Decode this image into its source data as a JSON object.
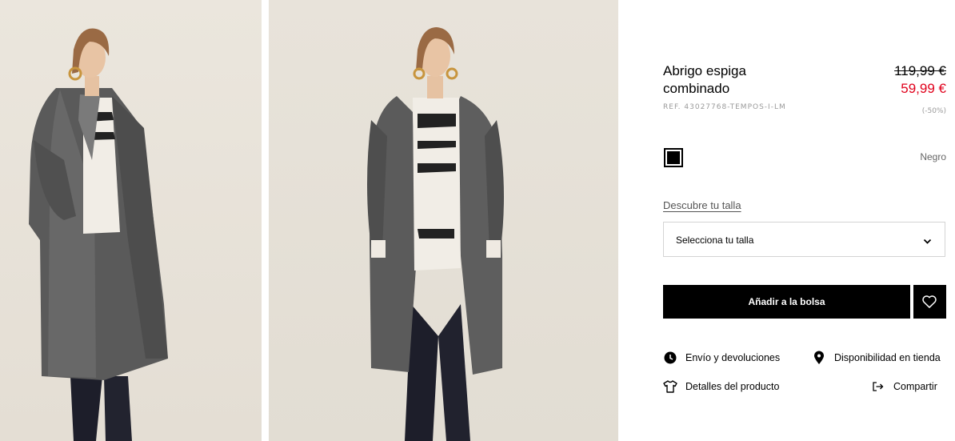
{
  "product": {
    "title": "Abrigo espiga combinado",
    "reference": "REF. 43027768-TEMPOS-I-LM",
    "original_price": "119,99 €",
    "sale_price": "59,99 €",
    "discount": "(-50%)",
    "sale_color": "#e0001b"
  },
  "color": {
    "selected_name": "Negro",
    "swatch_hex": "#000000"
  },
  "size": {
    "guide_link": "Descubre tu talla",
    "select_label": "Selecciona tu talla"
  },
  "actions": {
    "add_to_bag": "Añadir a la bolsa",
    "wishlist_icon": "heart-icon"
  },
  "links": {
    "shipping": "Envío y devoluciones",
    "store_availability": "Disponibilidad en tienda",
    "product_details": "Detalles del producto",
    "share": "Compartir"
  },
  "icons": {
    "shipping": "clock-icon",
    "store_availability": "map-pin-icon",
    "product_details": "tshirt-icon",
    "share": "share-icon"
  }
}
